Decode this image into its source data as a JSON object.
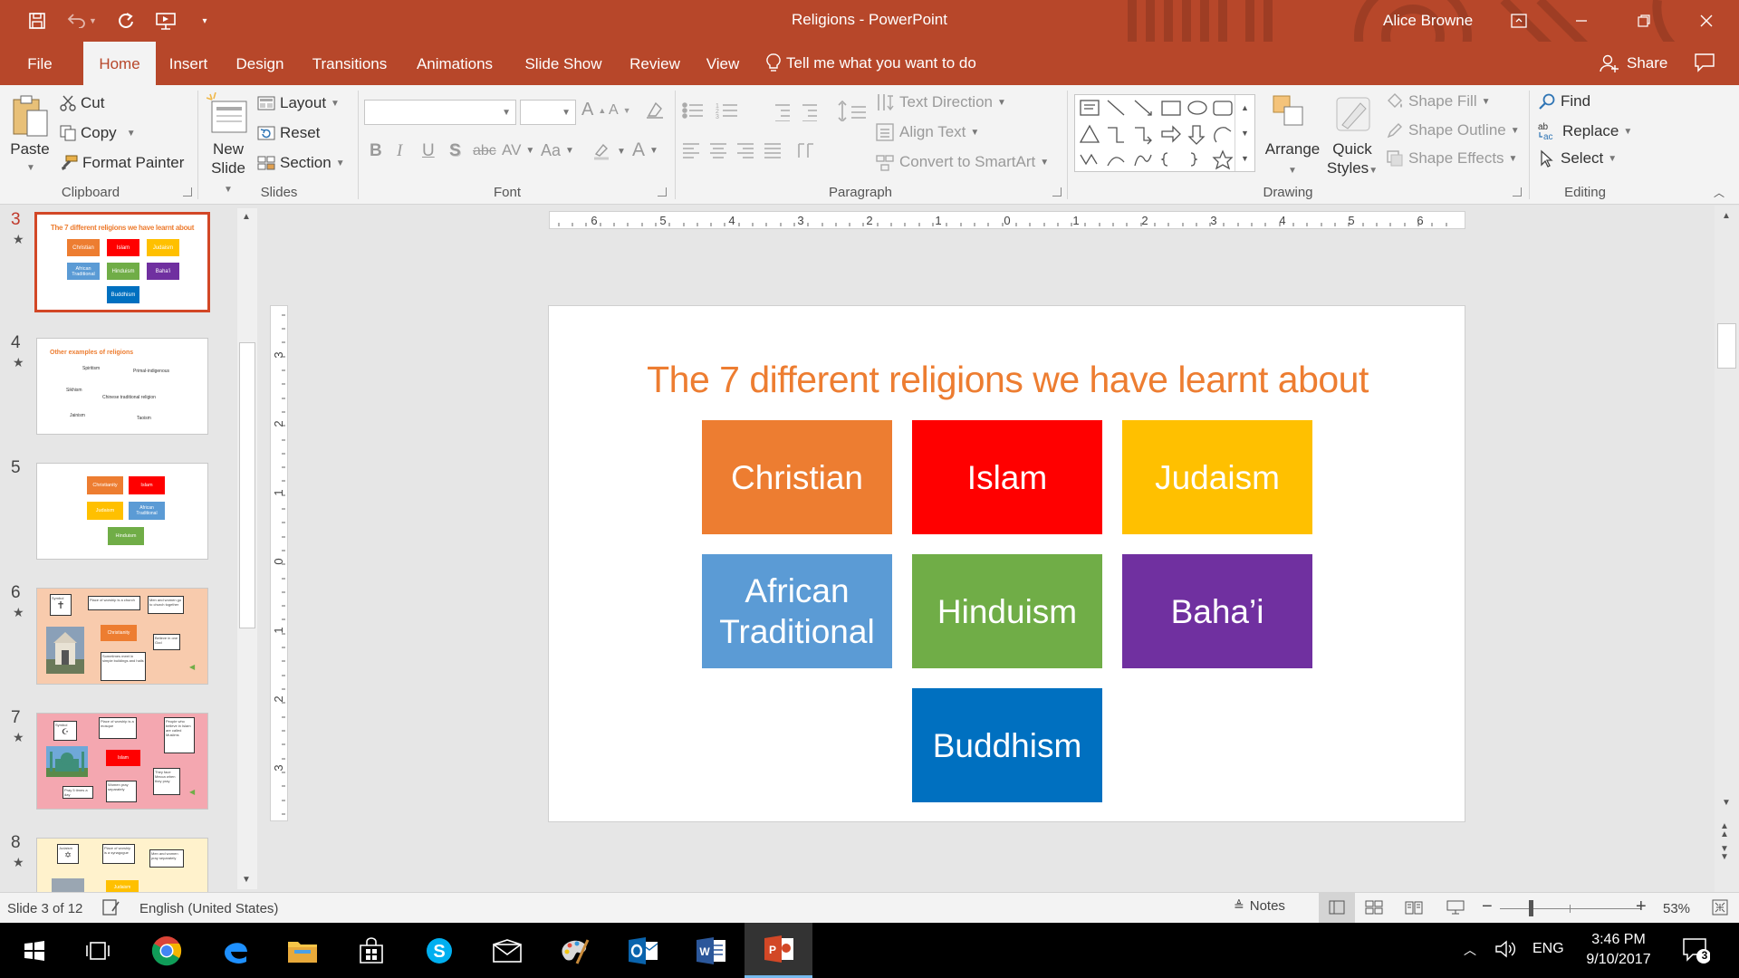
{
  "window": {
    "title": "Religions  -  PowerPoint",
    "user": "Alice Browne"
  },
  "tabs": [
    "File",
    "Home",
    "Insert",
    "Design",
    "Transitions",
    "Animations",
    "Slide Show",
    "Review",
    "View"
  ],
  "active_tab": "Home",
  "tell_me": "Tell me what you want to do",
  "share": "Share",
  "ribbon": {
    "clipboard": {
      "label": "Clipboard",
      "paste": "Paste",
      "cut": "Cut",
      "copy": "Copy",
      "format_painter": "Format Painter"
    },
    "slides": {
      "label": "Slides",
      "new_slide_1": "New",
      "new_slide_2": "Slide",
      "layout": "Layout",
      "reset": "Reset",
      "section": "Section"
    },
    "font": {
      "label": "Font",
      "bold": "B",
      "italic": "I",
      "underline": "U",
      "shadow": "S",
      "strike": "abc",
      "spacing": "AV",
      "case": "Aa",
      "grow": "A",
      "shrink": "A"
    },
    "paragraph": {
      "label": "Paragraph",
      "text_direction": "Text Direction",
      "align_text": "Align Text",
      "convert_smartart": "Convert to SmartArt"
    },
    "drawing": {
      "label": "Drawing",
      "arrange": "Arrange",
      "quick_styles_1": "Quick",
      "quick_styles_2": "Styles",
      "shape_fill": "Shape Fill",
      "shape_outline": "Shape Outline",
      "shape_effects": "Shape Effects"
    },
    "editing": {
      "label": "Editing",
      "find": "Find",
      "replace": "Replace",
      "select": "Select"
    }
  },
  "thumbnails": [
    {
      "num": "3",
      "star": true,
      "title": "The 7 different religions we have learnt about",
      "boxes": [
        "Christian",
        "Islam",
        "Judaism",
        "African Traditional",
        "Hinduism",
        "Baha'i",
        "Buddhism"
      ]
    },
    {
      "num": "4",
      "star": true,
      "title": "Other examples of religions",
      "items": [
        "Spiritism",
        "Primal-indigenous",
        "Sikhism",
        "Chinese traditional religion",
        "Jainism",
        "Taoism"
      ]
    },
    {
      "num": "5",
      "star": false,
      "boxes": [
        "Christianity",
        "Islam",
        "Judaism",
        "African Traditional",
        "Hinduism"
      ]
    },
    {
      "num": "6",
      "star": true,
      "texts": [
        "Symbol",
        "Place of worship is a church",
        "Men and women go to church together",
        "Christianity",
        "Believe in one God",
        "Sometimes meet in simple buildings and halls"
      ]
    },
    {
      "num": "7",
      "star": true,
      "texts": [
        "Symbol",
        "Place of worship is a mosque",
        "People who believe in Islam are called Muslims",
        "Islam",
        "They face Mecca when they pray",
        "Pray 5 times a day",
        "Women pray separately"
      ]
    },
    {
      "num": "8",
      "star": true,
      "texts": [
        "Judaism",
        "Place of worship is a synagogue",
        "Men and women pray separately",
        "Judaism"
      ]
    }
  ],
  "slide": {
    "title": "The 7 different religions we have learnt about",
    "boxes": [
      {
        "label": "Christian",
        "color": "#ed7d31"
      },
      {
        "label": "Islam",
        "color": "#ff0000"
      },
      {
        "label": "Judaism",
        "color": "#ffc000"
      },
      {
        "label": "African Traditional",
        "color": "#5b9bd5"
      },
      {
        "label": "Hinduism",
        "color": "#70ad47"
      },
      {
        "label": "Baha’i",
        "color": "#7030a0"
      },
      {
        "label": "Buddhism",
        "color": "#0070c0"
      }
    ]
  },
  "status": {
    "slide_of": "Slide 3 of 12",
    "language": "English (United States)",
    "notes": "Notes",
    "zoom": "53%"
  },
  "taskbar": {
    "lang": "ENG",
    "time": "3:46 PM",
    "date": "9/10/2017",
    "notif_count": "3"
  },
  "colors": {
    "accent": "#b7472a",
    "selected_thumb": "#d24726"
  }
}
